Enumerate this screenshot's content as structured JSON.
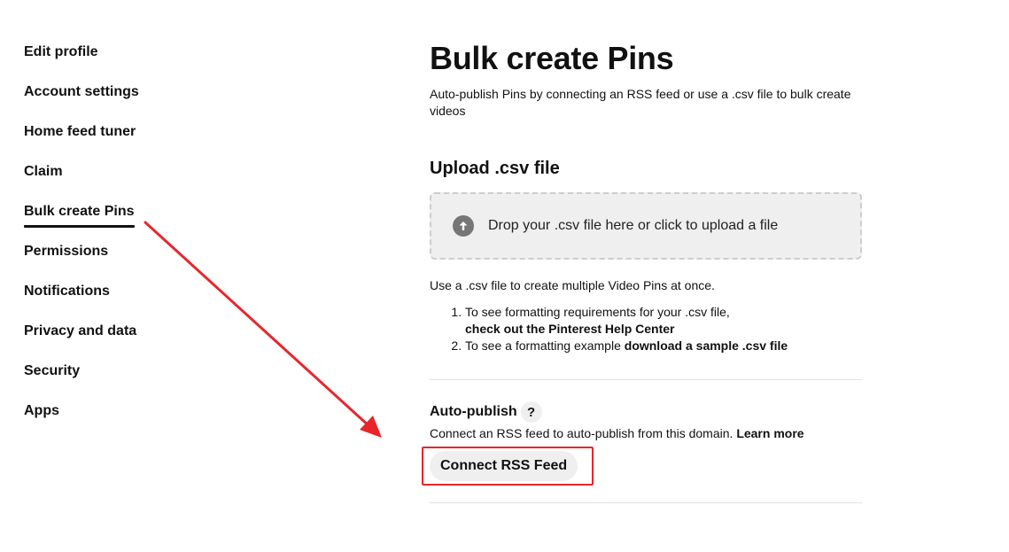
{
  "sidebar": {
    "items": [
      {
        "label": "Edit profile"
      },
      {
        "label": "Account settings"
      },
      {
        "label": "Home feed tuner"
      },
      {
        "label": "Claim"
      },
      {
        "label": "Bulk create Pins"
      },
      {
        "label": "Permissions"
      },
      {
        "label": "Notifications"
      },
      {
        "label": "Privacy and data"
      },
      {
        "label": "Security"
      },
      {
        "label": "Apps"
      }
    ],
    "active_index": 4
  },
  "main": {
    "title": "Bulk create Pins",
    "subtitle": "Auto-publish Pins by connecting an RSS feed or use a .csv file to bulk create videos",
    "upload": {
      "title": "Upload .csv file",
      "dropzone_text": "Drop your .csv file here or click to upload a file",
      "dropzone_icon": "upload-arrow-icon",
      "help_intro": "Use a .csv file to create multiple Video Pins at once.",
      "steps": [
        {
          "text": "To see formatting requirements for your .csv file,",
          "link": "check out the Pinterest Help Center"
        },
        {
          "text": "To see a formatting example ",
          "link": "download a sample .csv file"
        }
      ]
    },
    "auto_publish": {
      "title": "Auto-publish",
      "help_symbol": "?",
      "description": "Connect an RSS feed to auto-publish from this domain. ",
      "learn_more": "Learn more",
      "button_label": "Connect RSS Feed"
    }
  },
  "colors": {
    "annotation": "#e8262a",
    "dropzone_bg": "#efefef",
    "button_bg": "#efefef",
    "text": "#111111"
  }
}
